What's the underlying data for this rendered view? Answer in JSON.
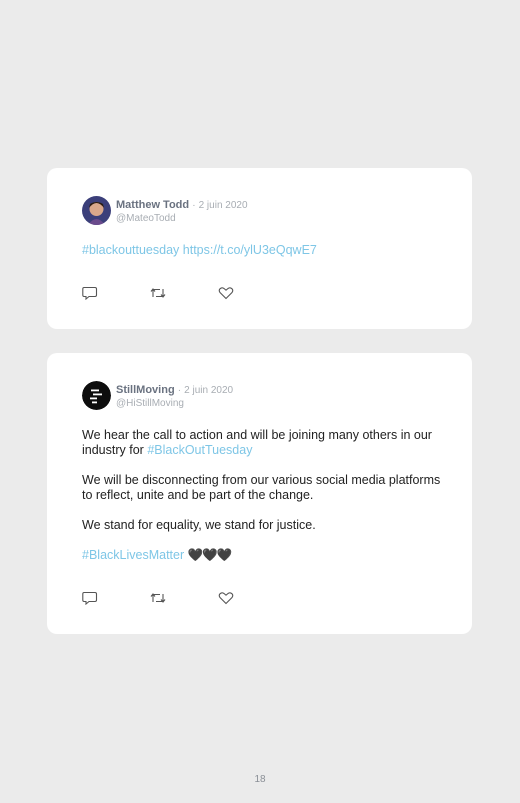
{
  "tweets": [
    {
      "name": "Matthew Todd",
      "separator": "·",
      "date": "2 juin 2020",
      "handle": "@MateoTodd",
      "paragraphs": [
        {
          "tag": "#blackouttuesday",
          "text": " https://t.co/ylU3eQqwE7"
        }
      ]
    },
    {
      "name": "StillMoving",
      "separator": "·",
      "date": "2 juin 2020",
      "handle": "@HiStillMoving",
      "p1_text": "We hear the call to action and will be joining many others in our industry for ",
      "p1_tag": "#BlackOutTuesday",
      "p2_text": "We will be disconnecting from our various social media platforms to reflect, unite and be part of the change.",
      "p3_text": "We stand for equality, we stand for justice.",
      "p4_tag": "#BlackLivesMatter",
      "p4_emoji": "🖤🖤🖤"
    }
  ],
  "icons": [
    "reply-icon",
    "retweet-icon",
    "like-icon"
  ],
  "colors": {
    "hashtag": "#7ec6e6",
    "card": "#ffffff",
    "background": "#ebebeb"
  },
  "page_number": "18"
}
